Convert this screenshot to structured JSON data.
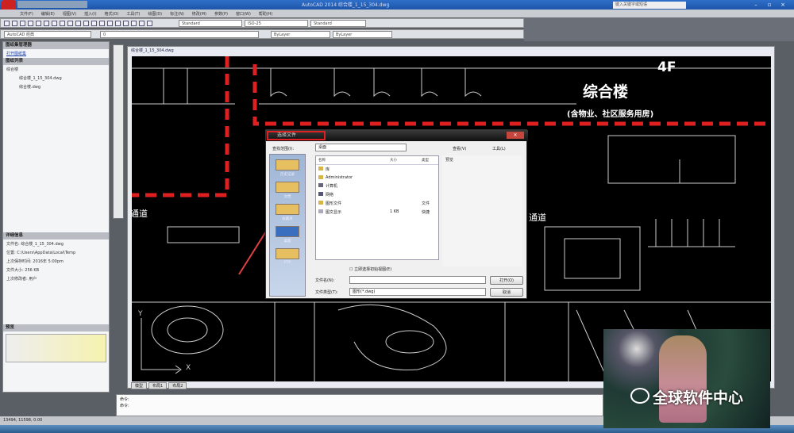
{
  "window": {
    "title": "AutoCAD 2014  综合楼_1_15_304.dwg",
    "search_placeholder": "键入关键字或短语"
  },
  "menu": [
    "文件(F)",
    "编辑(E)",
    "视图(V)",
    "插入(I)",
    "格式(O)",
    "工具(T)",
    "绘图(D)",
    "标注(N)",
    "修改(M)",
    "参数(P)",
    "窗口(W)",
    "帮助(H)"
  ],
  "toolbars": {
    "workspace": "AutoCAD 经典",
    "layer": "0",
    "textstyle": "Standard",
    "dimstyle": "ISO-25",
    "color": "ByLayer",
    "linetype": "ByLayer"
  },
  "left_panel": {
    "title": "图纸集管理器",
    "link": "打开图纸集",
    "section1": "图纸列表",
    "tree": [
      "综合楼",
      "综合楼_1_15_304.dwg",
      "综合楼.dwg"
    ],
    "section2": "详细信息",
    "details": [
      "文件名: 综合楼_1_15_304.dwg",
      "位置: C:\\Users\\AppData\\Local\\Temp",
      "上次保存时间: 2016年 5:00pm",
      "文件大小: 256 KB",
      "上次修改者: 用户"
    ],
    "section3": "预览"
  },
  "drawing": {
    "tab_title": "综合楼_1_15_304.dwg",
    "building_label": "综合楼",
    "floor_label": "4F",
    "building_sub": "(含物业、社区服务用房)",
    "corridor_left": "通道",
    "corridor_center": "通道",
    "axis_y": "Y",
    "axis_x": "X",
    "layout_tabs": [
      "模型",
      "布局1",
      "布局2"
    ]
  },
  "dialog": {
    "title": "选择文件",
    "lookin_label": "查找范围(I):",
    "lookin_value": "桌面",
    "columns": [
      "名称",
      "大小",
      "类型"
    ],
    "files": [
      {
        "name": "库",
        "size": "",
        "type": ""
      },
      {
        "name": "Administrator",
        "size": "",
        "type": ""
      },
      {
        "name": "计算机",
        "size": "",
        "type": ""
      },
      {
        "name": "网络",
        "size": "",
        "type": ""
      },
      {
        "name": "图形文件",
        "size": "",
        "type": "文件"
      },
      {
        "name": "图文显示",
        "size": "1 KB",
        "type": "快捷"
      }
    ],
    "places": [
      "历史记录",
      "文档",
      "收藏夹",
      "桌面",
      "FTP"
    ],
    "preview_label": "预览",
    "views_label": "查看(V)",
    "tools_label": "工具(L)",
    "checkbox_label": "立即选择初始视图(E)",
    "filename_label": "文件名(N):",
    "filename_value": "",
    "filetype_label": "文件类型(T):",
    "filetype_value": "图形(*.dwg)",
    "open_button": "打开(O)",
    "cancel_button": "取消"
  },
  "command": {
    "line1": "命令:",
    "line2": "命令:"
  },
  "status": {
    "coords": "13494, 11598, 0.00"
  },
  "watermark": "全球软件中心",
  "colors": {
    "accent_red": "#e02020",
    "canvas": "#000000"
  }
}
